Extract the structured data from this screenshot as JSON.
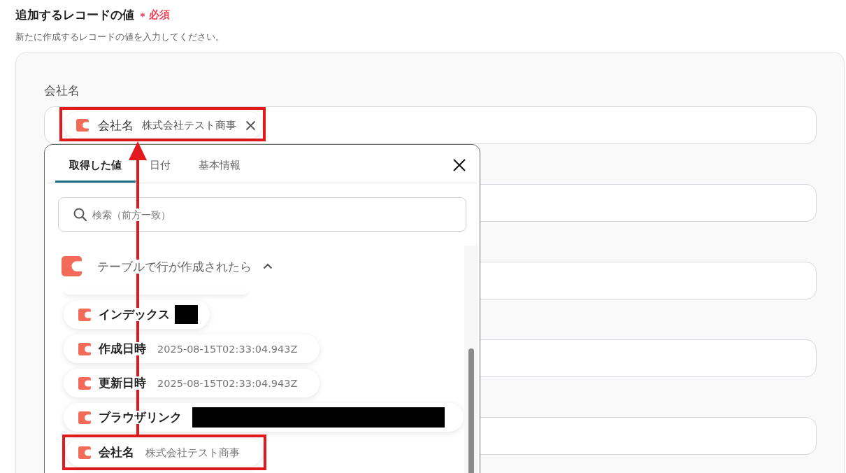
{
  "section": {
    "title": "追加するレコードの値",
    "required_mark": "＊",
    "required_label": "必須",
    "description": "新たに作成するレコードの値を入力してください。"
  },
  "fields": [
    {
      "kind": "token",
      "label": "会社名",
      "token": {
        "name": "会社名",
        "value": "株式会社テスト商事",
        "highlighted": true
      }
    },
    {
      "kind": "empty"
    },
    {
      "kind": "empty"
    },
    {
      "kind": "empty"
    },
    {
      "kind": "empty"
    }
  ],
  "picker": {
    "tabs": [
      {
        "label": "取得した値",
        "selected": true
      },
      {
        "label": "日付",
        "selected": false
      },
      {
        "label": "基本情報",
        "selected": false
      }
    ],
    "search": {
      "placeholder": "検索（前方一致）"
    },
    "group": {
      "title": "テーブルで行が作成されたら",
      "expanded": true
    },
    "items": [
      {
        "name": "インデックス",
        "redacted": true,
        "highlighted": false
      },
      {
        "name": "作成日時",
        "value": "2025-08-15T02:33:04.943Z",
        "redacted": false,
        "highlighted": false
      },
      {
        "name": "更新日時",
        "value": "2025-08-15T02:33:04.943Z",
        "redacted": false,
        "highlighted": false
      },
      {
        "name": "ブラウザリンク",
        "redacted": true,
        "highlighted": false
      },
      {
        "name": "会社名",
        "value": "株式会社テスト商事",
        "redacted": false,
        "highlighted": true
      }
    ]
  }
}
